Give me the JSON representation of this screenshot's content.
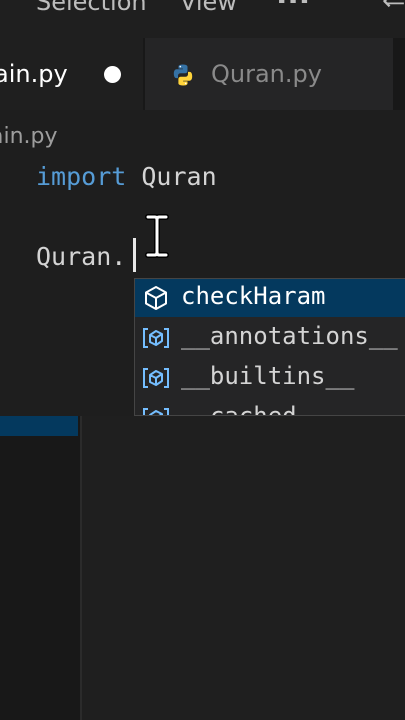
{
  "menubar": {
    "items": [
      "Selection",
      "View"
    ],
    "more_label": "...",
    "back_label": "⇐"
  },
  "tabs": [
    {
      "label": "ain.py",
      "dirty": true,
      "active": true
    },
    {
      "label": "Quran.py",
      "icon": "python-icon",
      "active": false
    }
  ],
  "breadcrumb": "ain.py",
  "code": {
    "line1_keyword": "import",
    "line1_module": " Quran",
    "line2_text": "Quran."
  },
  "suggestions": [
    {
      "label": "checkHaram",
      "icon": "method-cube-icon",
      "selected": true
    },
    {
      "label": "__annotations__",
      "icon": "variable-icon",
      "selected": false
    },
    {
      "label": "__builtins__",
      "icon": "variable-icon",
      "selected": false
    },
    {
      "label": "__cached__",
      "icon": "variable-icon",
      "selected": false
    }
  ],
  "colors": {
    "keyword": "#569cd6",
    "selection": "#04395e",
    "editor_bg": "#1e1e1e",
    "icon_blue": "#75beff",
    "python_blue": "#3572A5",
    "python_yellow": "#FFD43B"
  }
}
